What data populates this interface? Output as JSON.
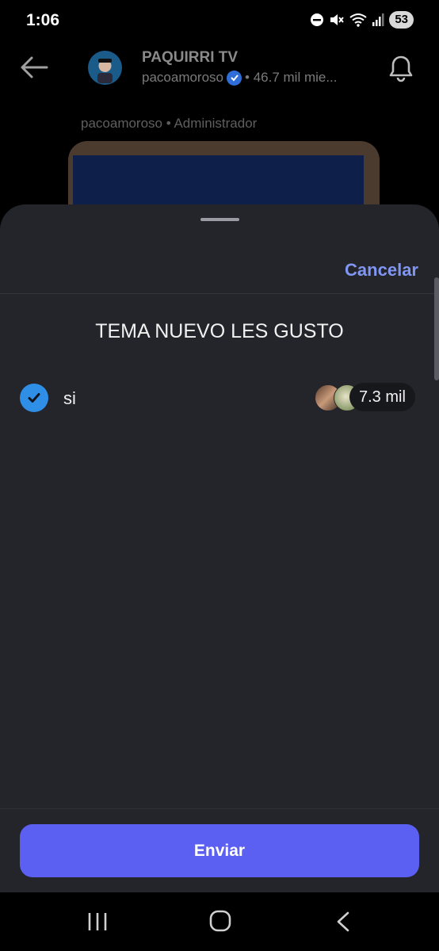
{
  "status": {
    "time": "1:06",
    "battery": "53"
  },
  "channel": {
    "title": "PAQUIRRI TV",
    "handle": "pacoamoroso",
    "members": "• 46.7 mil mie..."
  },
  "post": {
    "sender": "pacoamoroso • Administrador"
  },
  "sheet": {
    "cancel_label": "Cancelar",
    "question": "TEMA NUEVO LES GUSTO",
    "options": [
      {
        "label": "si",
        "votes": "7.3 mil",
        "selected": true
      }
    ],
    "submit_label": "Enviar"
  },
  "colors": {
    "accent": "#5b5ff2",
    "link": "#8096f3",
    "check": "#2f8ee6",
    "sheet_bg": "#24252b"
  },
  "icons": [
    "back-arrow-icon",
    "verified-icon",
    "bell-icon",
    "checkmark-icon",
    "recents-icon",
    "home-icon",
    "nav-back-icon"
  ]
}
